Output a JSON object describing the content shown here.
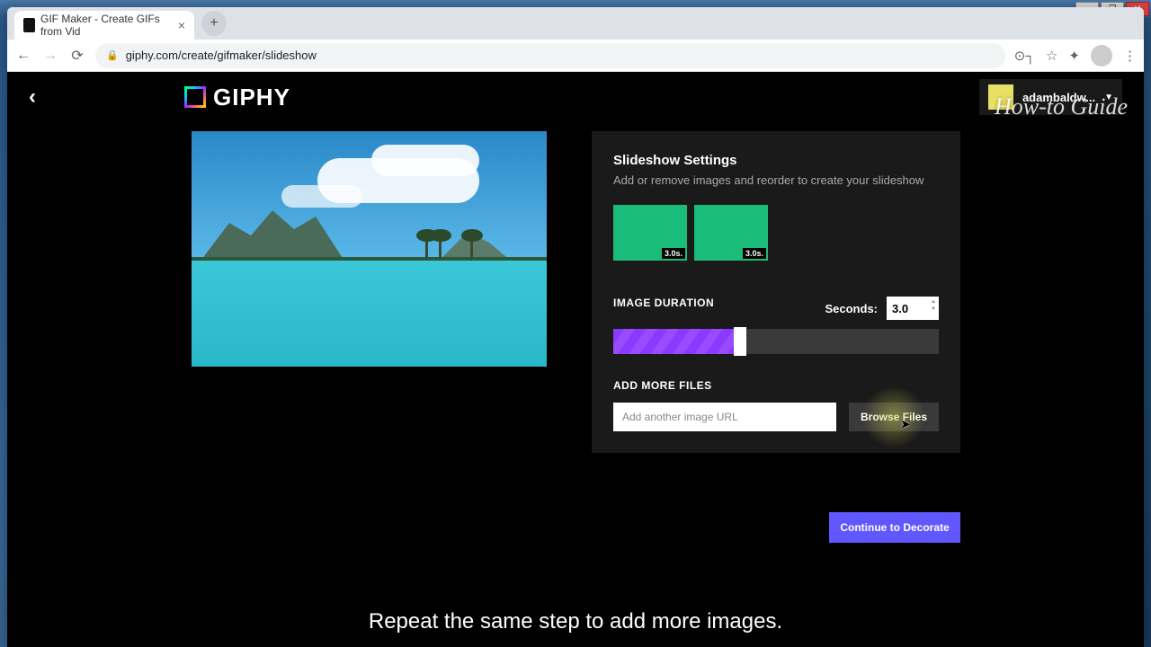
{
  "window": {
    "tab_title": "GIF Maker - Create GIFs from Vid",
    "url": "giphy.com/create/gifmaker/slideshow"
  },
  "watermark": "How-to Guide",
  "header": {
    "logo_text": "GIPHY",
    "username": "adambaldw..."
  },
  "settings": {
    "title": "Slideshow Settings",
    "subtitle": "Add or remove images and reorder to create your slideshow",
    "thumbs": [
      {
        "duration": "3.0s."
      },
      {
        "duration": "3.0s."
      }
    ],
    "image_duration_label": "IMAGE DURATION",
    "seconds_label": "Seconds:",
    "seconds_value": "3.0",
    "add_more_label": "ADD MORE FILES",
    "url_placeholder": "Add another image URL",
    "browse_label": "Browse Files"
  },
  "continue_label": "Continue to Decorate",
  "caption": "Repeat the same step to add more images."
}
